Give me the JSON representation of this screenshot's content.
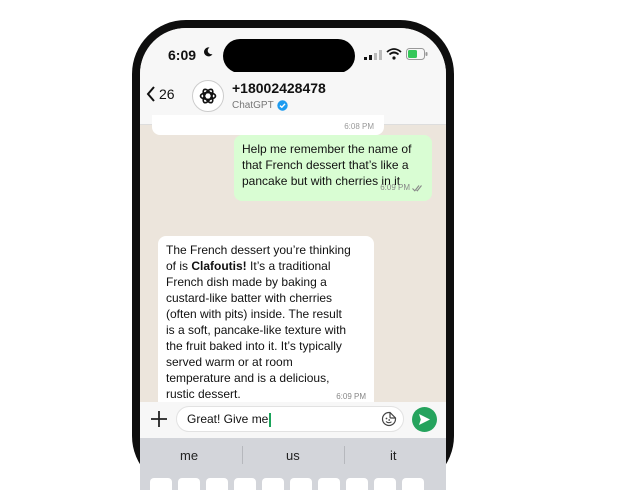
{
  "status_bar": {
    "time": "6:09"
  },
  "header": {
    "back_count": "26",
    "contact_name": "+18002428478",
    "contact_subtitle": "ChatGPT"
  },
  "messages": [
    {
      "direction": "outgoing",
      "lines": [
        "Help me remember the name of",
        "that French dessert that’s like a",
        "pancake but with cherries in it"
      ],
      "time": "6:09 PM"
    },
    {
      "direction": "incoming",
      "lines": [
        "The French dessert you’re thinking",
        "of is Clafoutis! It’s a traditional",
        "French dish made by baking a",
        "custard-like batter with cherries",
        "(often with pits) inside. The result",
        "is a soft, pancake-like texture with",
        "the fruit baked into it. It’s typically",
        "served warm or at room",
        "temperature and is a delicious,",
        "rustic dessert."
      ],
      "time": "6:09 PM"
    }
  ],
  "previous_message_time": "6:08 PM",
  "composer": {
    "typed_text": "Great! Give me"
  },
  "keyboard_suggestions": [
    "me",
    "us",
    "it"
  ],
  "colors": {
    "outgoing_bubble": "#d9fdd3",
    "incoming_bubble": "#ffffff",
    "send_button": "#25a35d",
    "verified_badge": "#1d9bf0"
  }
}
